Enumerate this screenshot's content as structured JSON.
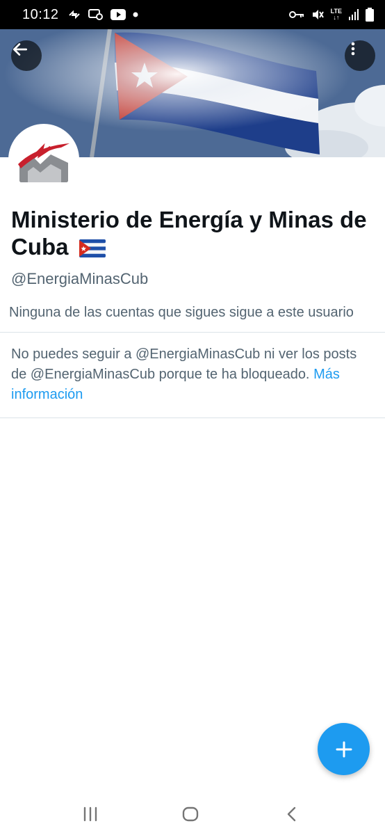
{
  "status_bar": {
    "time": "10:12",
    "network": "LTE",
    "icons": [
      "sync-icon",
      "message-icon",
      "youtube-icon",
      "dot-icon",
      "vpn-key-icon",
      "mute-icon",
      "signal-icon",
      "battery-icon"
    ]
  },
  "header": {
    "back_icon": "arrow-left-icon",
    "more_icon": "more-vertical-icon",
    "banner": "cuban-flag-photo"
  },
  "profile": {
    "name": "Ministerio de Energía y Minas de Cuba",
    "handle": "@EnergiaMinasCub",
    "follow_note": "Ninguna de las cuentas que sigues sigue a este usuario",
    "blocked_message": "No puedes seguir a @EnergiaMinasCub ni ver los posts de @EnergiaMinasCub porque te ha bloqueado.",
    "more_info_link": "Más información"
  },
  "fab": {
    "icon": "plus-icon",
    "color": "#1d9bf0"
  },
  "colors": {
    "accent": "#1d9bf0",
    "secondary_text": "#536471",
    "primary_text": "#0f1419"
  },
  "nav_bar": {
    "icons": [
      "recent-apps-icon",
      "home-icon",
      "back-icon"
    ]
  }
}
